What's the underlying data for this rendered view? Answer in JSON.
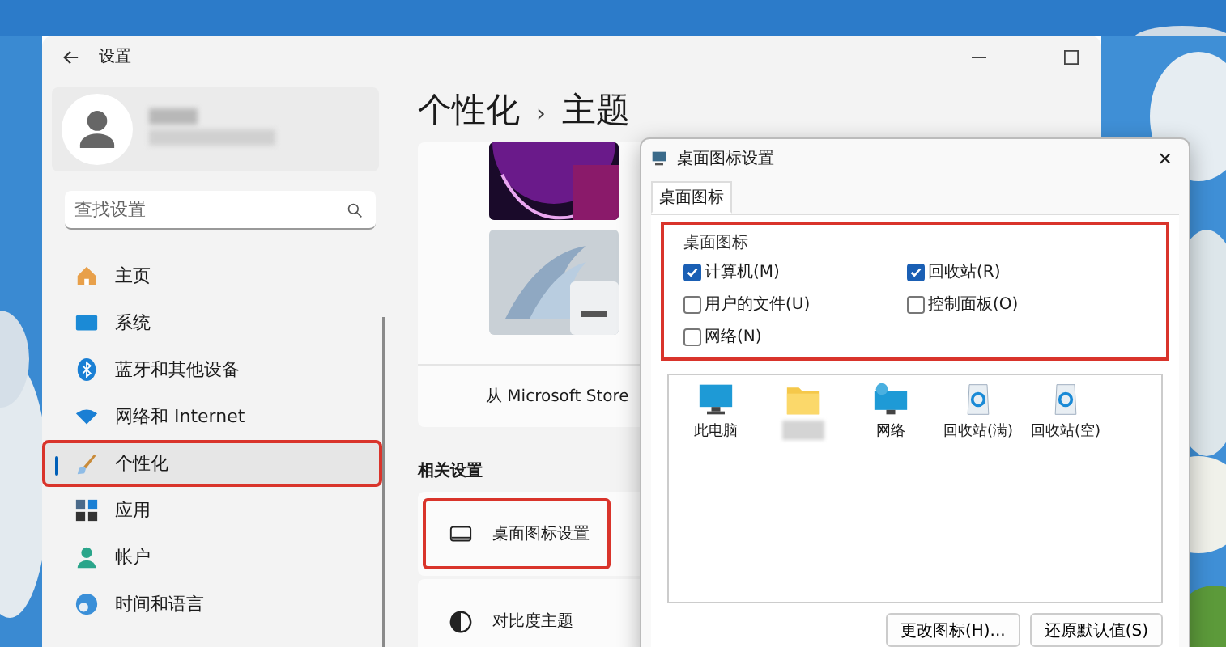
{
  "settings_window": {
    "title": "设置",
    "search": {
      "placeholder": "查找设置"
    },
    "nav": [
      {
        "label": "主页",
        "kind": "home",
        "selected": false,
        "highlighted": false
      },
      {
        "label": "系统",
        "kind": "system",
        "selected": false,
        "highlighted": false
      },
      {
        "label": "蓝牙和其他设备",
        "kind": "bluetooth",
        "selected": false,
        "highlighted": false
      },
      {
        "label": "网络和 Internet",
        "kind": "wifi",
        "selected": false,
        "highlighted": false
      },
      {
        "label": "个性化",
        "kind": "brush",
        "selected": true,
        "highlighted": true
      },
      {
        "label": "应用",
        "kind": "apps",
        "selected": false,
        "highlighted": false
      },
      {
        "label": "帐户",
        "kind": "account",
        "selected": false,
        "highlighted": false
      },
      {
        "label": "时间和语言",
        "kind": "globe",
        "selected": false,
        "highlighted": false
      }
    ],
    "breadcrumb": {
      "parent": "个性化",
      "separator": "›",
      "current": "主题"
    },
    "store_link": "从 Microsoft Store",
    "related_heading": "相关设置",
    "related": [
      {
        "label": "桌面图标设置",
        "kind": "monitor",
        "highlighted": true
      },
      {
        "label": "对比度主题",
        "kind": "contrast",
        "highlighted": false
      }
    ]
  },
  "dialog": {
    "title": "桌面图标设置",
    "close": "✕",
    "tabs": [
      {
        "label": "桌面图标",
        "selected": true
      }
    ],
    "group": {
      "title": "桌面图标",
      "highlighted": true,
      "checkboxes": [
        {
          "label": "计算机(M)",
          "checked": true
        },
        {
          "label": "回收站(R)",
          "checked": true
        },
        {
          "label": "用户的文件(U)",
          "checked": false
        },
        {
          "label": "控制面板(O)",
          "checked": false
        },
        {
          "label": "网络(N)",
          "checked": false
        }
      ]
    },
    "icons": [
      {
        "label": "此电脑",
        "kind": "monitor"
      },
      {
        "kind": "folder"
      },
      {
        "label": "网络",
        "kind": "network"
      },
      {
        "label": "回收站(满)",
        "kind": "recycle"
      },
      {
        "label": "回收站(空)",
        "kind": "recycle"
      }
    ],
    "buttons": [
      "更改图标(H)...",
      "还原默认值(S)"
    ]
  }
}
